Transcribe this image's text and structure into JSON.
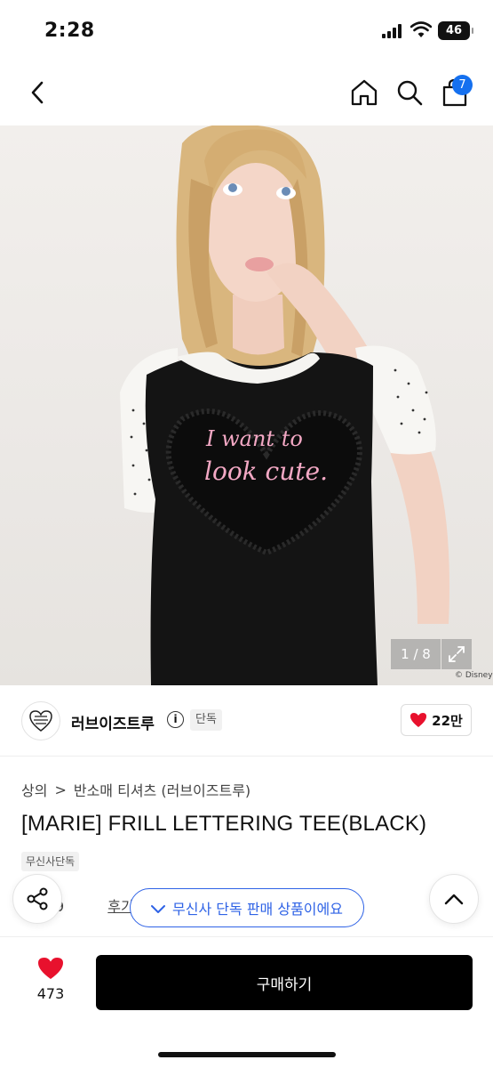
{
  "status_bar": {
    "time": "2:28",
    "battery": "46"
  },
  "nav": {
    "cart_count": "7"
  },
  "hero": {
    "shirt_text_line1": "I want to",
    "shirt_text_line2": "look cute.",
    "counter": "1 / 8",
    "copyright": "© Disney"
  },
  "brand": {
    "name": "러브이즈트루",
    "info_symbol": "i",
    "tag": "단독",
    "likes": "22만"
  },
  "product": {
    "breadcrumb": [
      "상의",
      "반소매 티셔츠 (러브이즈트루)"
    ],
    "breadcrumb_separator": ">",
    "title": "[MARIE] FRILL LETTERING TEE(BLACK)",
    "tag": "무신사단독",
    "rating_partial": "9",
    "reviews": "후기 11개"
  },
  "floating": {
    "exclusive_notice": "무신사 단독 판매 상품이에요"
  },
  "bottom_bar": {
    "wish_count": "473",
    "buy_label": "구매하기"
  },
  "colors": {
    "accent_blue": "#2f63e6",
    "badge_blue": "#1570ef",
    "heart_red": "#e8112d",
    "buy_black": "#000000"
  },
  "icons": [
    "back-icon",
    "home-icon",
    "search-icon",
    "cart-icon",
    "expand-icon",
    "info-icon",
    "heart-icon",
    "share-icon",
    "check-icon",
    "chevron-up-icon"
  ]
}
